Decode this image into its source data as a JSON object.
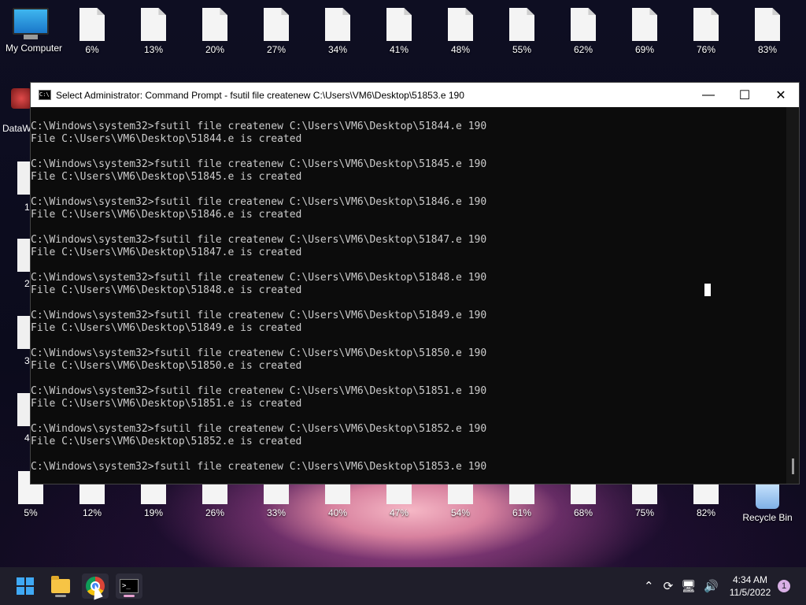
{
  "desktop": {
    "my_computer_label": "My Computer",
    "top_row": [
      "6%",
      "13%",
      "20%",
      "27%",
      "34%",
      "41%",
      "48%",
      "55%",
      "62%",
      "69%",
      "76%",
      "83%"
    ],
    "bottom_row": [
      "5%",
      "12%",
      "19%",
      "26%",
      "33%",
      "40%",
      "47%",
      "54%",
      "61%",
      "68%",
      "75%",
      "82%"
    ],
    "recycle_bin_label": "Recycle Bin",
    "partial_shortcut_label": "DataW",
    "side_numbers": [
      "1",
      "2",
      "3",
      "4"
    ]
  },
  "cmd_window": {
    "title": "Select Administrator: Command Prompt - fsutil  file createnew C:\\Users\\VM6\\Desktop\\51853.e 190",
    "lines": [
      "C:\\Windows\\system32>fsutil file createnew C:\\Users\\VM6\\Desktop\\51844.e 190",
      "File C:\\Users\\VM6\\Desktop\\51844.e is created",
      "",
      "C:\\Windows\\system32>fsutil file createnew C:\\Users\\VM6\\Desktop\\51845.e 190",
      "File C:\\Users\\VM6\\Desktop\\51845.e is created",
      "",
      "C:\\Windows\\system32>fsutil file createnew C:\\Users\\VM6\\Desktop\\51846.e 190",
      "File C:\\Users\\VM6\\Desktop\\51846.e is created",
      "",
      "C:\\Windows\\system32>fsutil file createnew C:\\Users\\VM6\\Desktop\\51847.e 190",
      "File C:\\Users\\VM6\\Desktop\\51847.e is created",
      "",
      "C:\\Windows\\system32>fsutil file createnew C:\\Users\\VM6\\Desktop\\51848.e 190",
      "File C:\\Users\\VM6\\Desktop\\51848.e is created",
      "",
      "C:\\Windows\\system32>fsutil file createnew C:\\Users\\VM6\\Desktop\\51849.e 190",
      "File C:\\Users\\VM6\\Desktop\\51849.e is created",
      "",
      "C:\\Windows\\system32>fsutil file createnew C:\\Users\\VM6\\Desktop\\51850.e 190",
      "File C:\\Users\\VM6\\Desktop\\51850.e is created",
      "",
      "C:\\Windows\\system32>fsutil file createnew C:\\Users\\VM6\\Desktop\\51851.e 190",
      "File C:\\Users\\VM6\\Desktop\\51851.e is created",
      "",
      "C:\\Windows\\system32>fsutil file createnew C:\\Users\\VM6\\Desktop\\51852.e 190",
      "File C:\\Users\\VM6\\Desktop\\51852.e is created",
      "",
      "C:\\Windows\\system32>fsutil file createnew C:\\Users\\VM6\\Desktop\\51853.e 190"
    ],
    "buttons": {
      "minimize": "—",
      "maximize": "☐",
      "close": "✕"
    }
  },
  "taskbar": {
    "clock_time": "4:34 AM",
    "clock_date": "11/5/2022",
    "notification_count": "1",
    "tray_icons": [
      "chevron-up-icon",
      "update-icon",
      "network-icon",
      "volume-icon"
    ]
  }
}
